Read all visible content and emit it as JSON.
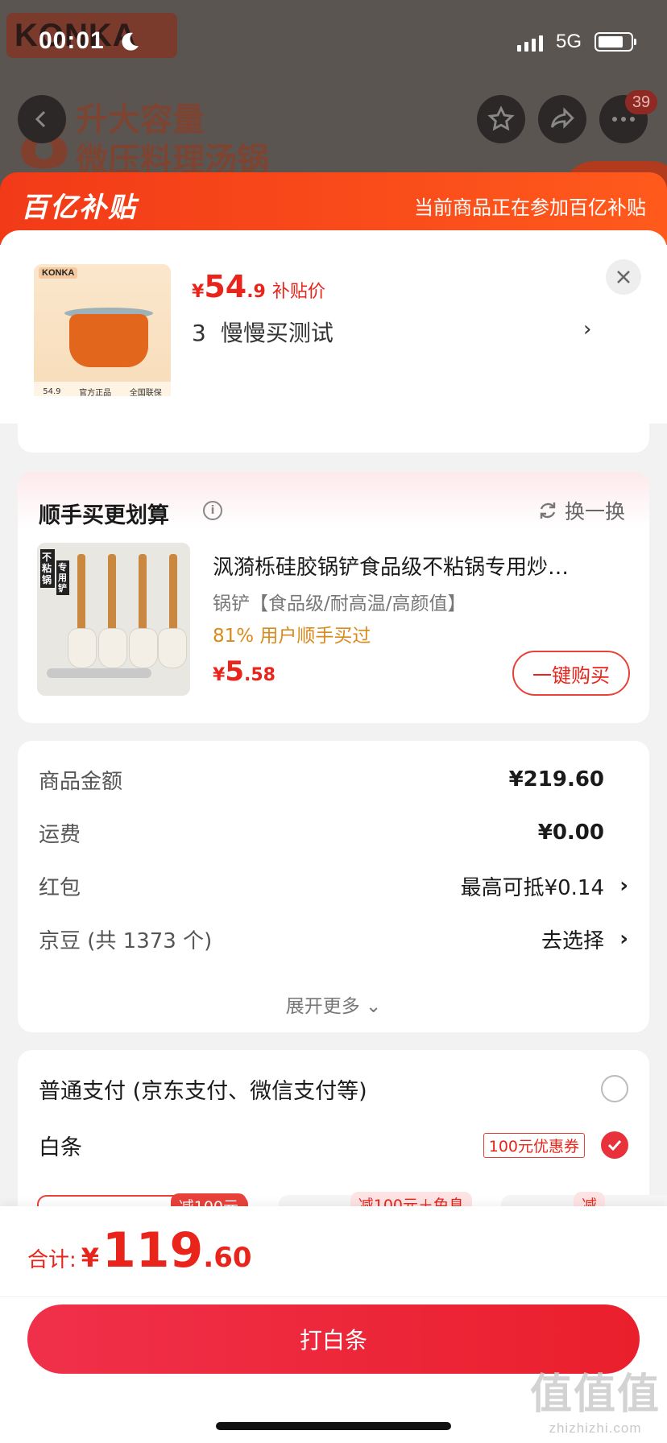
{
  "status_bar": {
    "time": "00:01",
    "network": "5G"
  },
  "background_page": {
    "brand": "KONKA",
    "title_number": "8",
    "title_lines": [
      "升大容量",
      "微压料理汤锅"
    ],
    "cart_badge": "39"
  },
  "subsidy_banner": {
    "logo": "百亿补贴",
    "note": "当前商品正在参加百亿补贴"
  },
  "product": {
    "thumb_brand": "KONKA",
    "thumb_price": "54.9",
    "thumb_tags": [
      "官方正品",
      "全国联保"
    ],
    "price_symbol": "¥",
    "price_int": "54",
    "price_dec": ".9",
    "price_label": "补贴价",
    "quantity": "3",
    "spec": "慢慢买测试"
  },
  "upsell": {
    "title": "顺手买更划算",
    "refresh_label": "换一换",
    "item": {
      "img_tag": "不粘锅",
      "img_tag2": "专用铲",
      "name": "沨漪栎硅胶锅铲食品级不粘锅专用炒…",
      "subtitle": "锅铲【食品级/耐高温/高颜值】",
      "rate": "81% 用户顺手买过",
      "price_symbol": "¥",
      "price_int": "5",
      "price_dec": ".58",
      "buy_label": "一键购买"
    }
  },
  "summary": {
    "rows": [
      {
        "label": "商品金额",
        "value": "¥219.60"
      },
      {
        "label": "运费",
        "value": "¥0.00"
      },
      {
        "label": "红包",
        "value": "最高可抵¥0.14"
      },
      {
        "label": "京豆 (共 1373 个)",
        "value": "去选择"
      }
    ],
    "expand_label": "展开更多"
  },
  "payment": {
    "options": [
      {
        "label": "普通支付 (京东支付、微信支付等)",
        "selected": false
      },
      {
        "label": "白条",
        "coupon": "100元优惠券",
        "selected": true
      }
    ],
    "plan_tags": [
      "减100元",
      "减100元＋免息",
      "减"
    ]
  },
  "bottom_bar": {
    "total_label": "合计:",
    "total_symbol": "¥",
    "total_int": "119",
    "total_dec": ".60",
    "pay_button": "打白条"
  },
  "watermark": {
    "big": "值值值",
    "small": "zhizhizhi.com"
  },
  "colors": {
    "accent": "#e8241b",
    "subsidy": "#f23a18",
    "rate": "#d98a1c"
  }
}
